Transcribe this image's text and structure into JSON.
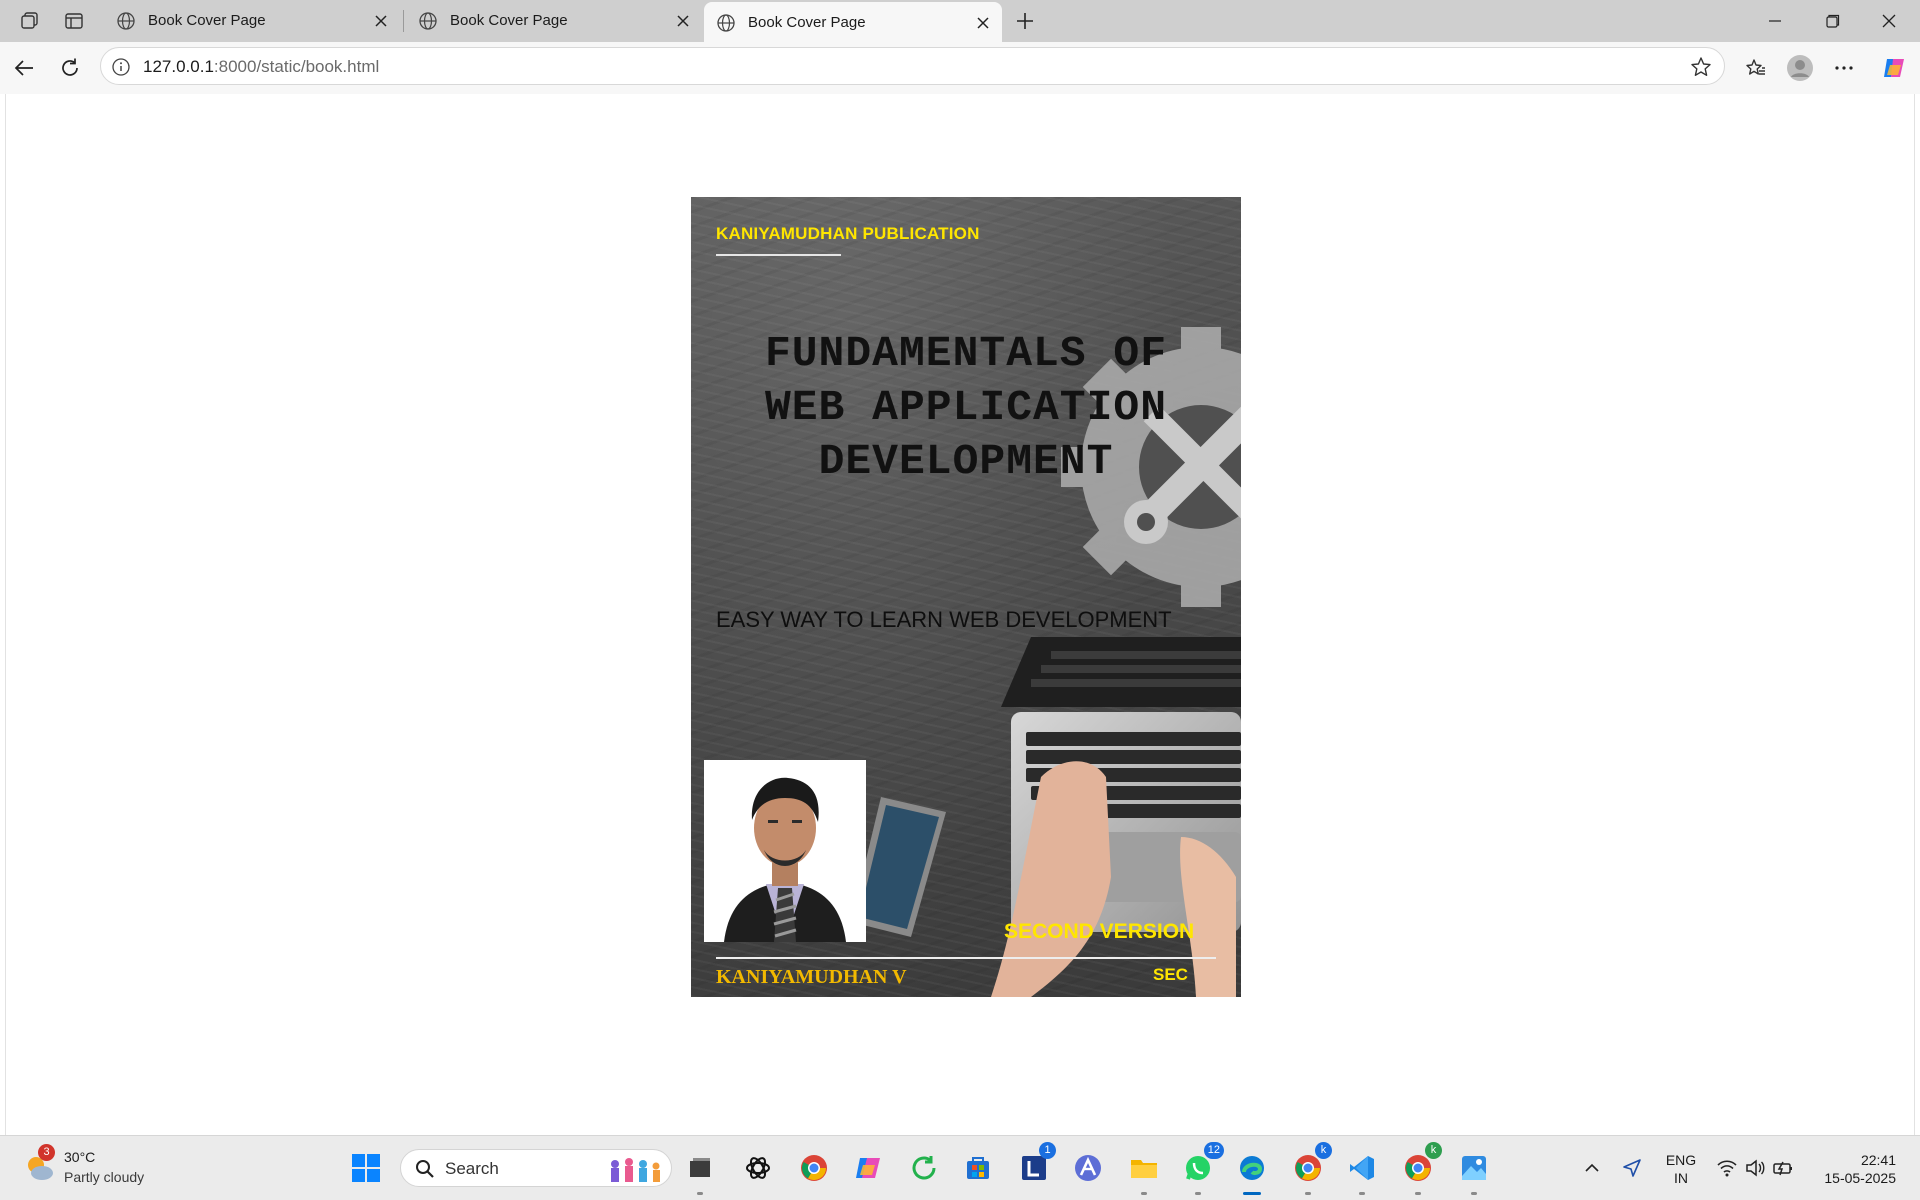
{
  "browser": {
    "tabs": [
      {
        "title": "Book Cover Page",
        "active": false
      },
      {
        "title": "Book Cover Page",
        "active": false
      },
      {
        "title": "Book Cover Page",
        "active": true
      }
    ],
    "address": {
      "host": "127.0.0.1",
      "path": ":8000/static/book.html"
    }
  },
  "cover": {
    "publisher": "KANIYAMUDHAN PUBLICATION",
    "title_lines": [
      "FUNDAMENTALS OF",
      "WEB APPLICATION",
      "DEVELOPMENT"
    ],
    "subtitle": "EASY WAY TO LEARN WEB DEVELOPMENT",
    "version": "SECOND VERSION",
    "author": "KANIYAMUDHAN V",
    "institute": "SEC",
    "colors": {
      "publisher": "#ffe600",
      "author": "#f2b900",
      "background": "#4b4b4b"
    }
  },
  "taskbar": {
    "weather": {
      "temp": "30°C",
      "condition": "Partly cloudy",
      "badge": "3"
    },
    "search_label": "Search",
    "badges": {
      "outlook": "1",
      "whatsapp": "12",
      "chrome1": "k",
      "chrome2": "k"
    },
    "language": {
      "line1": "ENG",
      "line2": "IN"
    },
    "clock": {
      "time": "22:41",
      "date": "15-05-2025"
    }
  }
}
